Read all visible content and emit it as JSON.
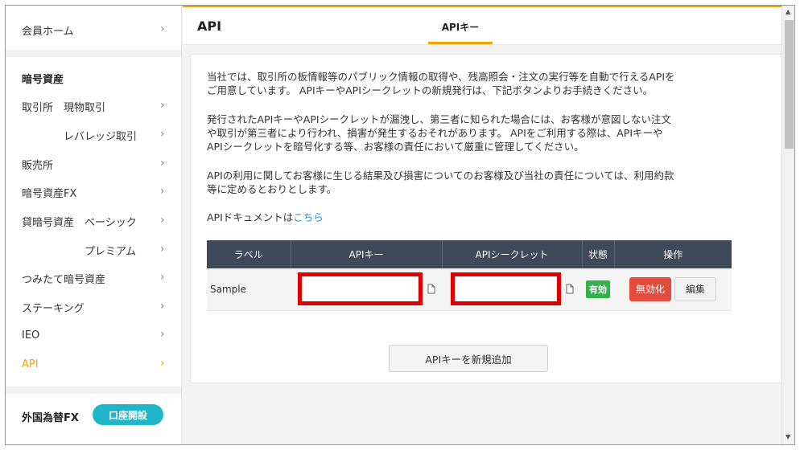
{
  "sidebar": {
    "home": "会員ホーム",
    "crypto_heading": "暗号資産",
    "exchange": "取引所",
    "exchange_spot": "現物取引",
    "exchange_leverage": "レバレッジ取引",
    "sales": "販売所",
    "crypto_fx": "暗号資産FX",
    "lending": "貸暗号資産",
    "lending_basic": "ベーシック",
    "lending_premium": "プレミアム",
    "tsumitate": "つみたて暗号資産",
    "staking": "ステーキング",
    "ieo": "IEO",
    "api": "API",
    "forex_heading": "外国為替FX",
    "open_account": "口座開設",
    "chevron": "›"
  },
  "header": {
    "title": "API",
    "tab": "APIキー"
  },
  "content": {
    "p1_line1": "当社では、取引所の板情報等のパブリック情報の取得や、残高照会・注文の実行等を自動で行えるAPIを",
    "p1_line2": "ご用意しています。 APIキーやAPIシークレットの新規発行は、下記ボタンよりお手続きください。",
    "p2_line1": "発行されたAPIキーやAPIシークレットが漏洩し、第三者に知られた場合には、お客様が意図しない注文",
    "p2_line2": "や取引が第三者により行われ、損害が発生するおそれがあります。 APIをご利用する際は、APIキーや",
    "p2_line3": "APIシークレットを暗号化する等、お客様の責任において厳重に管理してください。",
    "p3_line1": "APIの利用に関してお客様に生じる結果及び損害についてのお客様及び当社の責任については、利用約款",
    "p3_line2": "等に定めるとおりとします。",
    "doc_prefix": "APIドキュメントは",
    "doc_link": "こちら"
  },
  "table": {
    "headers": [
      "ラベル",
      "APIキー",
      "APIシークレット",
      "状態",
      "操作"
    ],
    "rows": [
      {
        "label": "Sample",
        "status": "有効",
        "disable": "無効化",
        "edit": "編集"
      }
    ]
  },
  "actions": {
    "add_key": "APIキーを新規追加"
  },
  "colors": {
    "accent": "#f5a300",
    "table_header": "#3e4a5a",
    "status_active": "#2fb34a",
    "danger": "#e54b3c",
    "link": "#2a8bd6",
    "open_badge": "#1fb6c9",
    "redaction": "#e00000"
  }
}
